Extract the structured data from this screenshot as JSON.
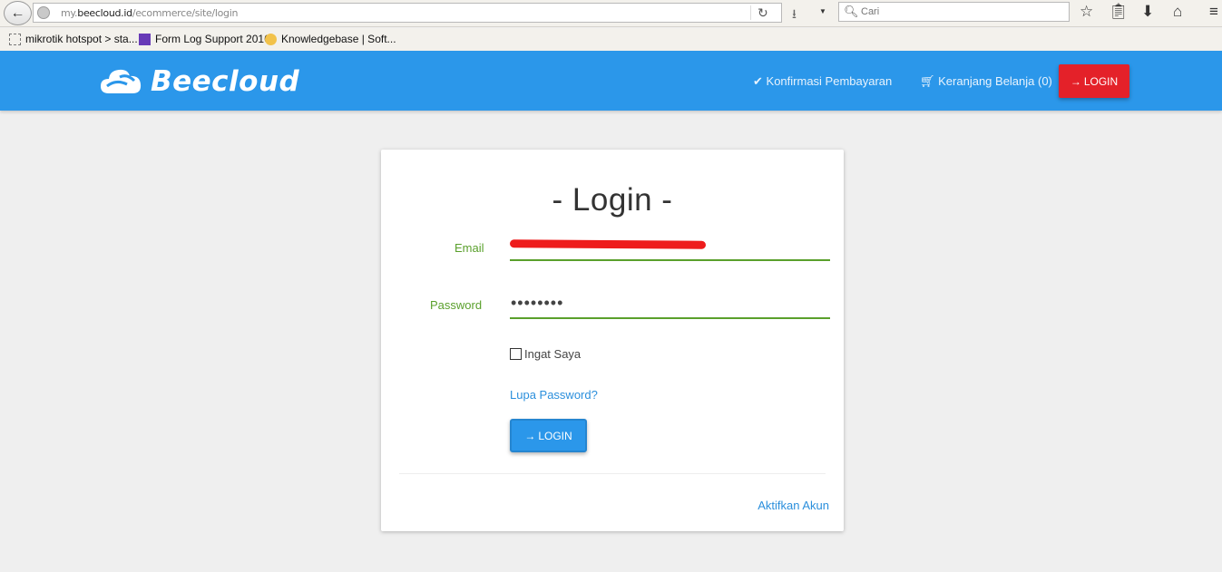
{
  "browser": {
    "back_icon": "back-arrow-icon",
    "url_prefix": "my.",
    "url_domain": "beecloud.id",
    "url_path": "/ecommerce/site/login",
    "search_placeholder": "Cari"
  },
  "bookmarks": [
    {
      "label": "mikrotik hotspot > sta..."
    },
    {
      "label": "Form Log Support 2016"
    },
    {
      "label": "Knowledgebase | Soft..."
    }
  ],
  "header": {
    "brand": "Beecloud",
    "nav_confirm_label": "Konfirmasi Pembayaran",
    "nav_cart_label": "Keranjang Belanja (0)",
    "login_label": "LOGIN",
    "login_color": "#e42129",
    "header_color": "#2b97ea"
  },
  "form": {
    "title": "- Login -",
    "email_label": "Email",
    "email_value": "",
    "password_label": "Password",
    "password_mask": "••••••••",
    "remember_label": "Ingat Saya",
    "remember_checked": false,
    "forgot_label": "Lupa Password?",
    "submit_label": "LOGIN",
    "activate_label": "Aktifkan Akun",
    "accent_color": "#5aa02c"
  }
}
